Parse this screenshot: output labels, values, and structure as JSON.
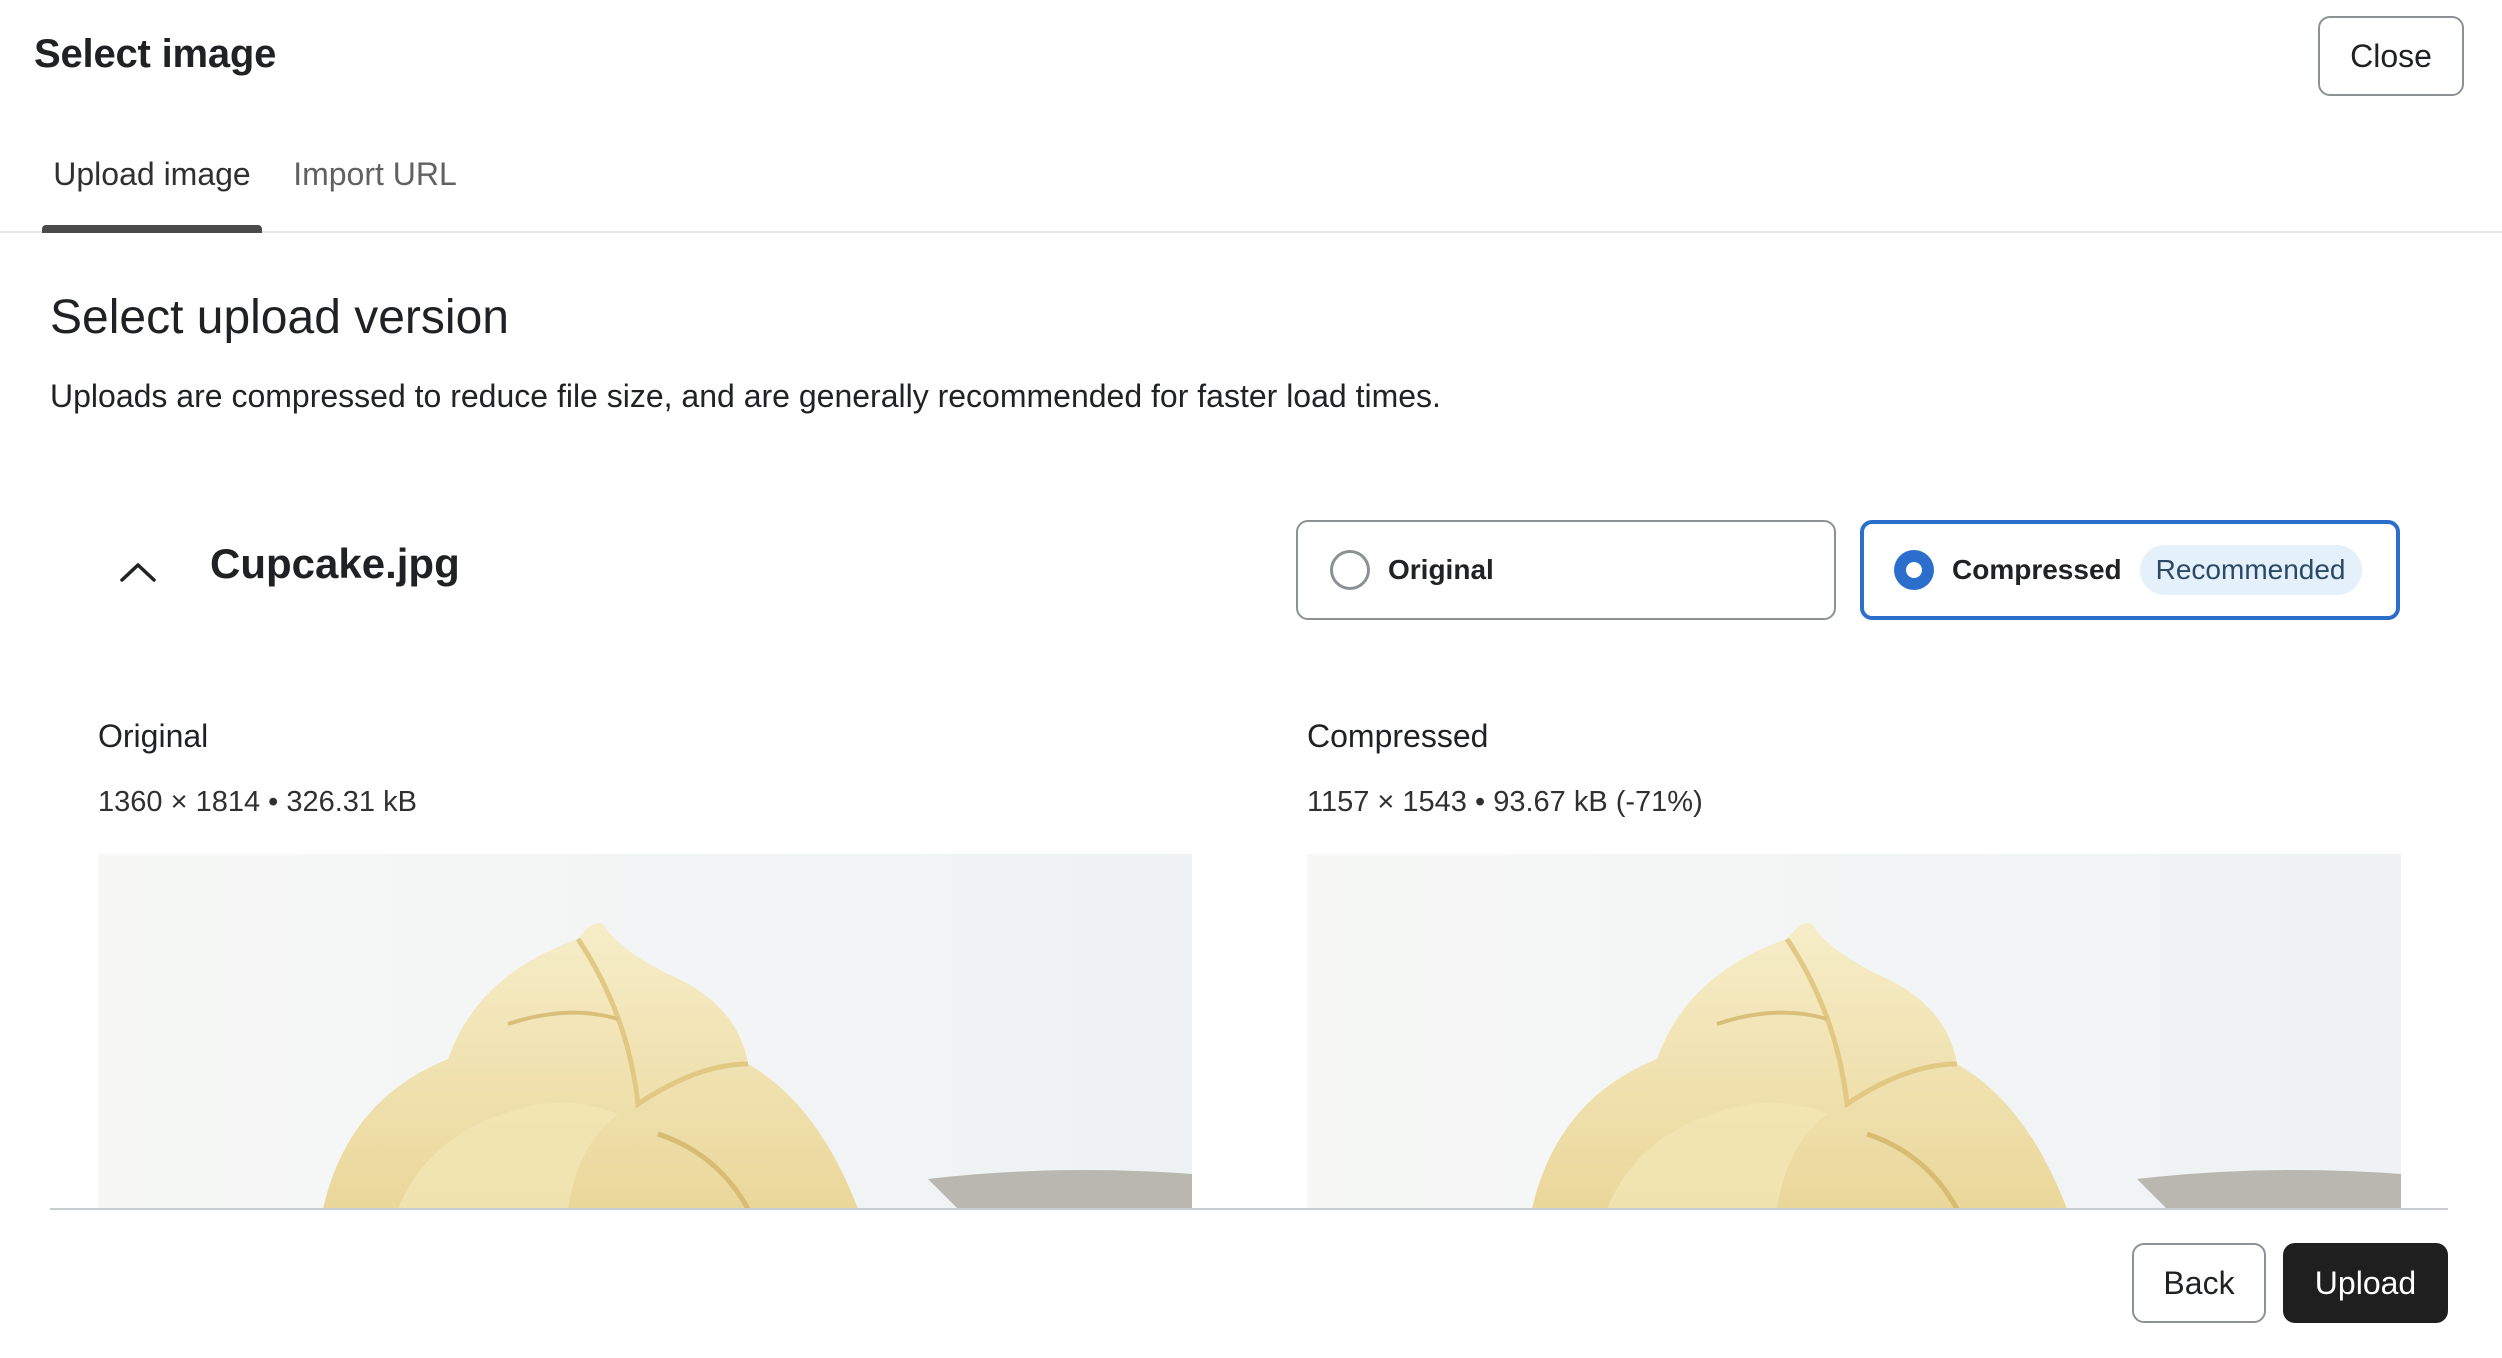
{
  "header": {
    "title": "Select image",
    "close_label": "Close"
  },
  "tabs": [
    {
      "label": "Upload image",
      "selected": true
    },
    {
      "label": "Import URL",
      "selected": false
    }
  ],
  "section": {
    "title": "Select upload version",
    "description": "Uploads are compressed to reduce file size, and are generally recommended for faster load times."
  },
  "file": {
    "name": "Cupcake.jpg",
    "expanded": true,
    "options": [
      {
        "label": "Original",
        "selected": false
      },
      {
        "label": "Compressed",
        "selected": true,
        "badge": "Recommended"
      }
    ]
  },
  "previews": [
    {
      "label": "Original",
      "meta": "1360 × 1814 • 326.31 kB"
    },
    {
      "label": "Compressed",
      "meta": "1157 × 1543 • 93.67 kB (-71%)"
    }
  ],
  "footer": {
    "back_label": "Back",
    "upload_label": "Upload"
  },
  "colors": {
    "accent": "#2c6ecb",
    "badge_bg": "#e4f0fa",
    "primary_button": "#1f1f1f"
  },
  "icons": {
    "collapse": "chevron-up-icon",
    "radio_off": "radio-unselected-icon",
    "radio_on": "radio-selected-icon"
  }
}
